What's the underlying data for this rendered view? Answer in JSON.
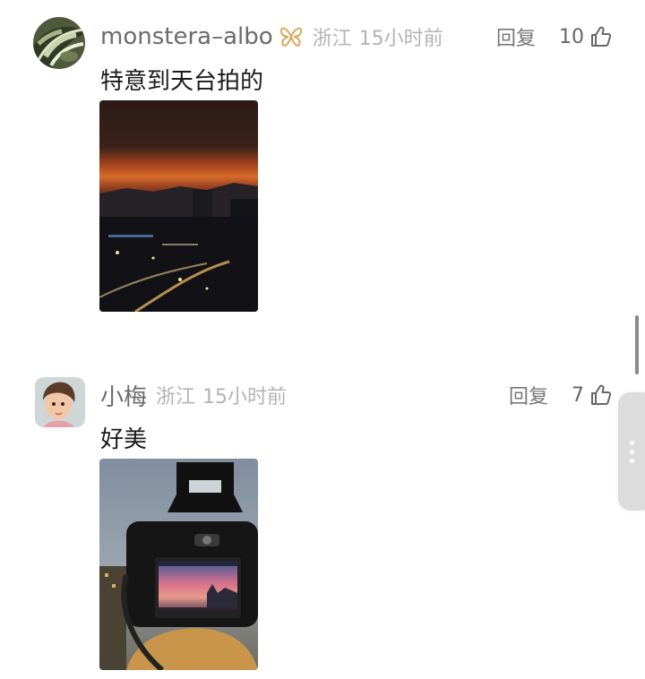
{
  "comments": [
    {
      "username": "monstera–albo",
      "badge_icon": "butterfly-badge-icon",
      "badge_color": "#d9a85a",
      "location": "浙江",
      "time": "15小时前",
      "reply_label": "回复",
      "like_count": "10",
      "text": "特意到天台拍的",
      "photo": "sunset-city-rooftop-photo"
    },
    {
      "username": "小梅",
      "location": "浙江",
      "time": "15小时前",
      "reply_label": "回复",
      "like_count": "7",
      "text": "好美",
      "photo": "camera-screen-sunset-photo"
    }
  ],
  "colors": {
    "username": "#6b6b6b",
    "meta": "#b3b3b3",
    "text": "#1a1a1a"
  }
}
